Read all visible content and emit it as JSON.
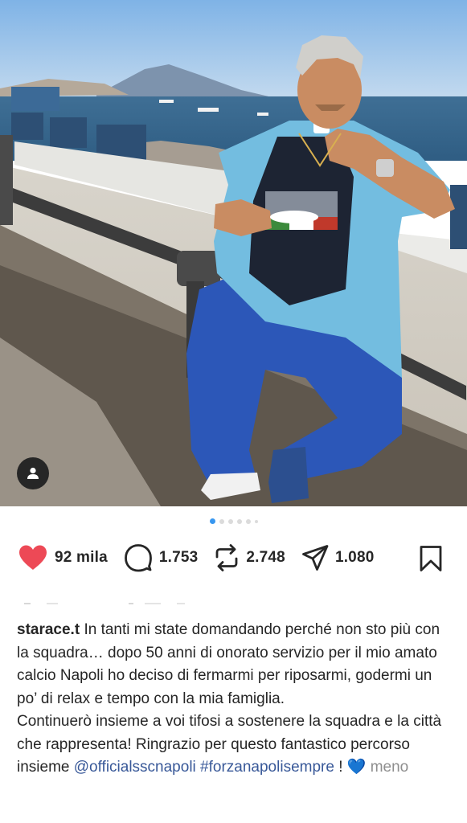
{
  "post": {
    "photo_alt_icons": [
      "user-tag-icon"
    ],
    "carousel": {
      "total": 6,
      "active": 1
    }
  },
  "actions": {
    "likes": "92 mila",
    "comments": "1.753",
    "reposts": "2.748",
    "shares": "1.080"
  },
  "caption": {
    "username": "starace.t",
    "text_1": "In tanti mi state domandando  perché non sto più con la squadra… dopo 50 anni di onorato servizio per il mio amato calcio Napoli  ho deciso di fermarmi per riposarmi, godermi un po’  di relax e tempo con la mia famiglia.",
    "text_2": "Continuerò  insieme a voi tifosi a sostenere la squadra e la città che rappresenta! Ringrazio per questo fantastico percorso insieme ",
    "mention": "@officialsscnapoli",
    "hashtag": "#forzanapolisempre",
    "text_3": " ! ",
    "emoji": "💙",
    "more_label": "meno"
  },
  "colors": {
    "like": "#ed4956",
    "link": "#385898",
    "dot_active": "#3897f0"
  }
}
